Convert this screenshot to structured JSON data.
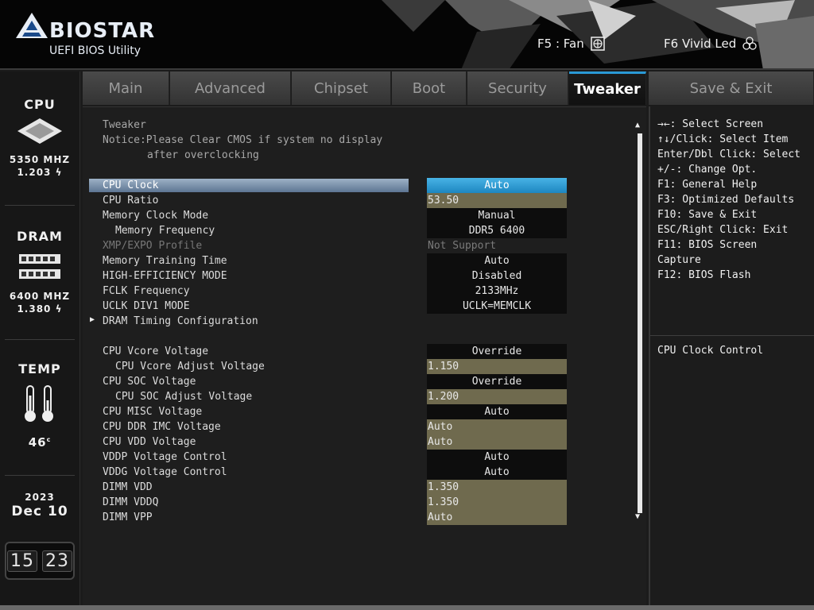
{
  "brand": {
    "name": "BIOSTAR",
    "subtitle": "UEFI BIOS Utility"
  },
  "hotkeys": [
    {
      "label": "F5 : Fan",
      "icon": "fan-icon"
    },
    {
      "label": "F6  Vivid Led",
      "icon": "led-icon"
    }
  ],
  "sidebar": {
    "cpu": {
      "title": "CPU",
      "freq": "5350 MHZ",
      "volt": "1.203"
    },
    "dram": {
      "title": "DRAM",
      "freq": "6400 MHZ",
      "volt": "1.380"
    },
    "temp": {
      "title": "TEMP",
      "value": "46",
      "unit": "c"
    },
    "date": {
      "year": "2023",
      "month": "Dec",
      "day": "10"
    },
    "time": {
      "hh": "15",
      "mm": "23"
    }
  },
  "tabs": [
    "Main",
    "Advanced",
    "Chipset",
    "Boot",
    "Security",
    "Tweaker",
    "Save & Exit"
  ],
  "active_tab": "Tweaker",
  "main": {
    "section_title": "Tweaker",
    "notice_line1": "Notice:Please Clear CMOS if system no display",
    "notice_line2": "after overclocking",
    "items": [
      {
        "label": "CPU Clock",
        "value": "Auto"
      },
      {
        "label": "CPU Ratio",
        "value": "53.50"
      },
      {
        "label": "Memory Clock Mode",
        "value": "Manual"
      },
      {
        "label": "Memory Frequency",
        "value": "DDR5 6400"
      },
      {
        "label": "XMP/EXPO Profile",
        "value": "Not Support"
      },
      {
        "label": "Memory Training Time",
        "value": "Auto"
      },
      {
        "label": "HIGH-EFFICIENCY MODE",
        "value": "Disabled"
      },
      {
        "label": "FCLK Frequency",
        "value": "2133MHz"
      },
      {
        "label": "UCLK DIV1 MODE",
        "value": "UCLK=MEMCLK"
      },
      {
        "label": "DRAM Timing Configuration",
        "value": ""
      },
      {
        "label": "CPU Vcore Voltage",
        "value": "Override"
      },
      {
        "label": "CPU Vcore Adjust Voltage",
        "value": "1.150"
      },
      {
        "label": "CPU SOC Voltage",
        "value": "Override"
      },
      {
        "label": "CPU SOC Adjust Voltage",
        "value": "1.200"
      },
      {
        "label": "CPU MISC Voltage",
        "value": "Auto"
      },
      {
        "label": "CPU DDR IMC Voltage",
        "value": "Auto"
      },
      {
        "label": "CPU VDD Voltage",
        "value": "Auto"
      },
      {
        "label": "VDDP Voltage Control",
        "value": "Auto"
      },
      {
        "label": "VDDG Voltage Control",
        "value": "Auto"
      },
      {
        "label": "DIMM VDD",
        "value": "1.350"
      },
      {
        "label": "DIMM VDDQ",
        "value": "1.350"
      },
      {
        "label": "DIMM VPP",
        "value": "Auto"
      }
    ]
  },
  "help": {
    "keys": [
      "→←: Select Screen",
      "↑↓/Click: Select Item",
      "Enter/Dbl Click: Select",
      "+/-: Change Opt.",
      "F1: General Help",
      "F3: Optimized Defaults",
      "F10: Save & Exit",
      "ESC/Right Click: Exit",
      "F11: BIOS Screen",
      "Capture",
      "F12: BIOS Flash"
    ],
    "description": "CPU Clock Control"
  },
  "colors": {
    "accent": "#2a9ad6",
    "value_bg": "#6f6a4e",
    "selected_label": "#7c93ad"
  }
}
